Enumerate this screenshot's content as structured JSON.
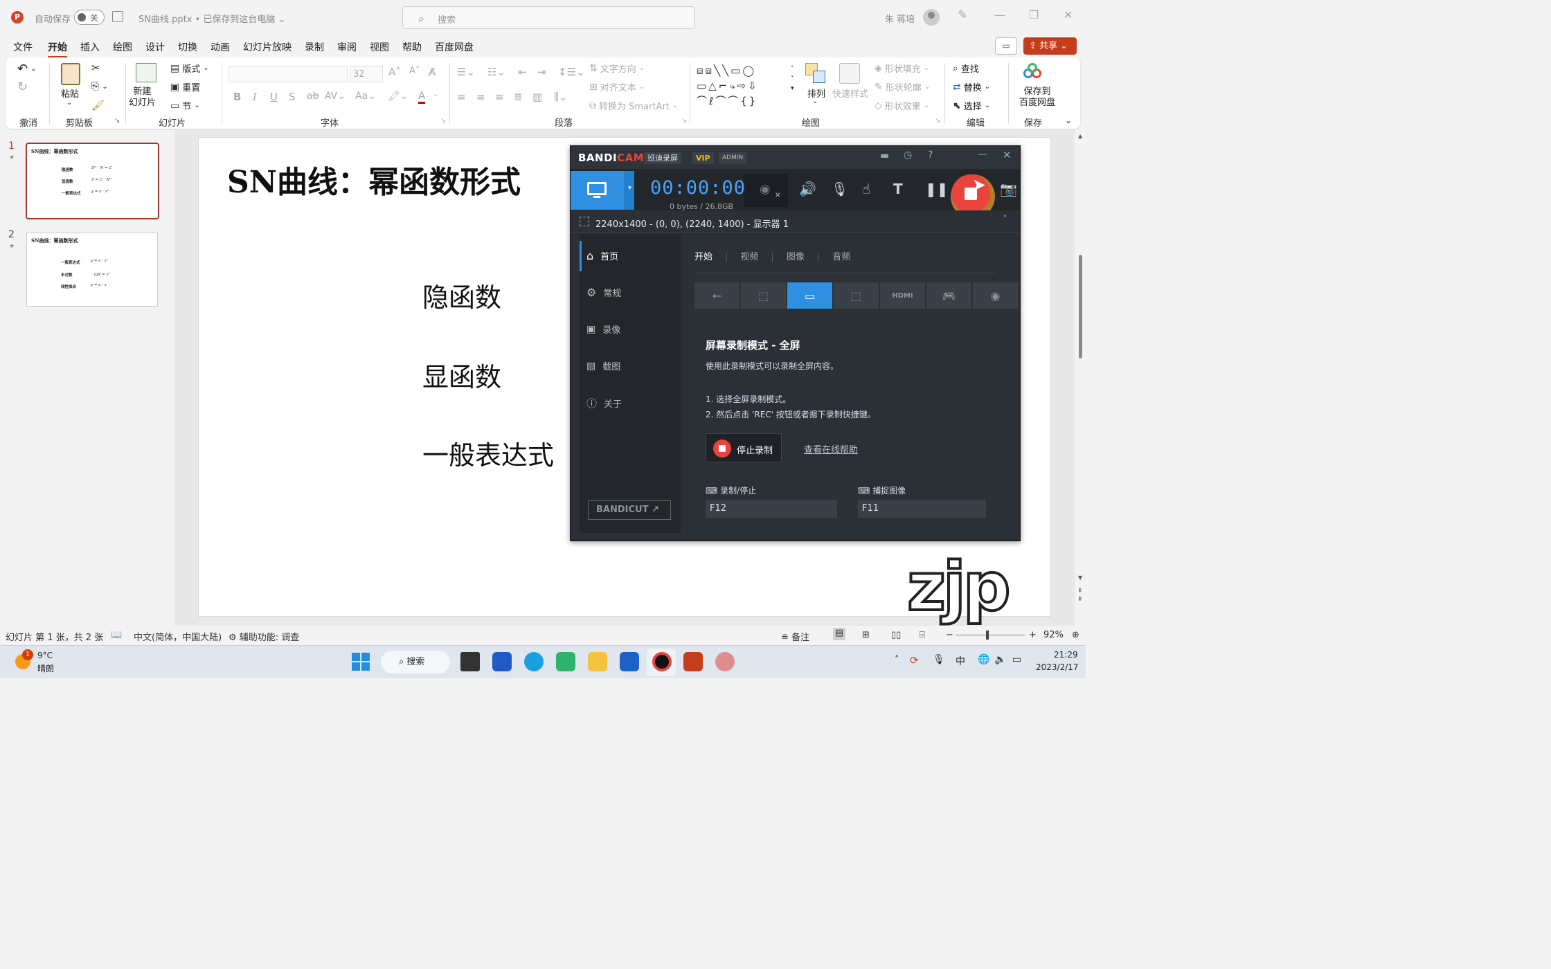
{
  "titlebar": {
    "app_icon": "P",
    "autosave_label": "自动保存",
    "autosave_state": "关",
    "doc_name": "SN曲线.pptx • 已保存到这台电脑 ⌄",
    "search_placeholder": "搜索",
    "user_name": "朱 蒋培"
  },
  "menu": {
    "items": [
      "文件",
      "开始",
      "插入",
      "绘图",
      "设计",
      "切换",
      "动画",
      "幻灯片放映",
      "录制",
      "审阅",
      "视图",
      "帮助",
      "百度网盘"
    ],
    "active_index": 1,
    "share_label": "共享"
  },
  "ribbon": {
    "groups": {
      "undo": "撤消",
      "clipboard": "剪贴板",
      "slides": "幻灯片",
      "font": "字体",
      "paragraph": "段落",
      "drawing": "绘图",
      "editing": "编辑",
      "save": "保存"
    },
    "paste": "粘贴",
    "new_slide": "新建\n幻灯片",
    "layout": "版式",
    "reset": "重置",
    "section": "节",
    "font_size": "32",
    "text_direction": "文字方向",
    "align_text": "对齐文本",
    "smartart": "转换为 SmartArt",
    "arrange": "排列",
    "quick_styles": "快速样式",
    "shape_fill": "形状填充",
    "shape_outline": "形状轮廓",
    "shape_effects": "形状效果",
    "find": "查找",
    "replace": "替换",
    "select": "选择",
    "save_to_baidu": "保存到\n百度网盘"
  },
  "slides_panel": {
    "slides": [
      {
        "num": "1",
        "title": "SN曲线：幂函数形式",
        "rows": [
          [
            "隐函数",
            "Sᵐ · N = C"
          ],
          [
            "显函数",
            "S = C · Nᵐ"
          ],
          [
            "一般表达式",
            "y = a · xᵇ"
          ]
        ]
      },
      {
        "num": "2",
        "title": "SN曲线：幂函数形式",
        "rows": [
          [
            "一般表达式",
            "y = a · xᵇ"
          ],
          [
            "半对数",
            "ㆍlgX = xᵇ"
          ],
          [
            "线性拟合",
            "y = a · x"
          ]
        ]
      }
    ]
  },
  "slide": {
    "title": "SN曲线：幂函数形式",
    "items": [
      "隐函数",
      "显函数",
      "一般表达式"
    ]
  },
  "bandicam": {
    "brand": "BANDI",
    "brand2": "CAM",
    "tag_cn": "班迪录屏",
    "tag_vip": "VIP",
    "tag_admin": "ADMIN",
    "timer": "00:00:00",
    "bytes": "0 bytes / 26.8GB",
    "area": "2240x1400 - (0, 0), (2240, 1400) - 显示器 1",
    "nav": [
      "首页",
      "常规",
      "录像",
      "截图",
      "关于"
    ],
    "tabs": [
      "开始",
      "视频",
      "图像",
      "音频"
    ],
    "heading": "屏幕录制模式 - 全屏",
    "desc": "使用此录制模式可以录制全屏内容。",
    "step1": "1. 选择全屏录制模式。",
    "step2": "2. 然后点击 'REC' 按钮或者摁下录制快捷键。",
    "stop_label": "停止录制",
    "help_link": "查看在线帮助",
    "hotkey_rec_label": "录制/停止",
    "hotkey_rec": "F12",
    "hotkey_cap_label": "捕捉图像",
    "hotkey_cap": "F11",
    "bandicut": "BANDICUT ↗"
  },
  "statusbar": {
    "slide_info": "幻灯片 第 1 张，共 2 张",
    "language": "中文(简体，中国大陆)",
    "accessibility": "辅助功能: 调查",
    "notes": "备注",
    "zoom": "92%"
  },
  "taskbar": {
    "weather_badge": "1",
    "temp": "9°C",
    "weather": "晴朗",
    "search": "搜索",
    "ime": "中",
    "time": "21:29",
    "date": "2023/2/17"
  },
  "watermark": "zjp"
}
